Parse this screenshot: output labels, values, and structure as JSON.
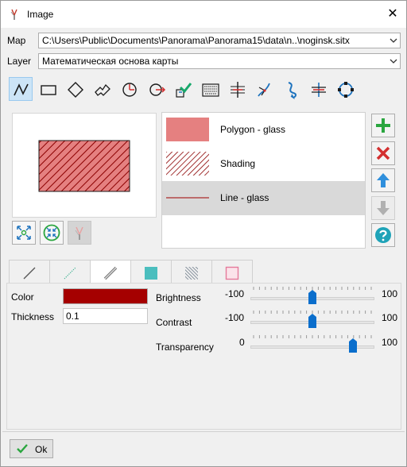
{
  "window": {
    "title": "Image",
    "close_glyph": "✕"
  },
  "map": {
    "label": "Map",
    "value": "C:\\Users\\Public\\Documents\\Panorama\\Panorama15\\data\\n..\\noginsk.sitx"
  },
  "layer": {
    "label": "Layer",
    "value": "Математическая основа карты"
  },
  "toolbar": {
    "tools": [
      "line-tool-icon",
      "rectangle-tool-icon",
      "diamond-tool-icon",
      "arrow-polygon-tool-icon",
      "circle-arc-tool-icon",
      "circle-arrow-tool-icon",
      "move-object-icon",
      "keyboard-icon",
      "vertical-line-marker-icon",
      "curve-arrows-icon",
      "s-curve-arrow-icon",
      "horizontal-split-marker-icon",
      "circle-nodes-icon"
    ]
  },
  "styles": [
    {
      "label": "Polygon - glass",
      "kind": "fill",
      "color": "#e58080"
    },
    {
      "label": "Shading",
      "kind": "hatch",
      "color": "#8b0000"
    },
    {
      "label": "Line - glass",
      "kind": "line",
      "color": "#a00000"
    }
  ],
  "selected_style": "Line - glass",
  "side_buttons": [
    "add-icon",
    "delete-icon",
    "move-up-icon",
    "move-down-icon",
    "help-icon"
  ],
  "tabs": [
    "solid-line-tab",
    "dotted-line-tab",
    "glass-line-tab",
    "fill-tab",
    "hatch-tab",
    "outline-tab"
  ],
  "properties": {
    "color_label": "Color",
    "color_value": "#a50000",
    "thickness_label": "Thickness",
    "thickness_value": "0.1",
    "brightness": {
      "label": "Brightness",
      "min": "-100",
      "max": "100",
      "value": 0
    },
    "contrast": {
      "label": "Contrast",
      "min": "-100",
      "max": "100",
      "value": 0
    },
    "transparency": {
      "label": "Transparency",
      "min": "0",
      "max": "100",
      "value": 85
    }
  },
  "ok_button": {
    "label": "Ok"
  },
  "colors": {
    "accent_blue": "#1e73be",
    "green": "#2aa63f",
    "red": "#d32f2f",
    "selection": "#d9d9d9"
  }
}
